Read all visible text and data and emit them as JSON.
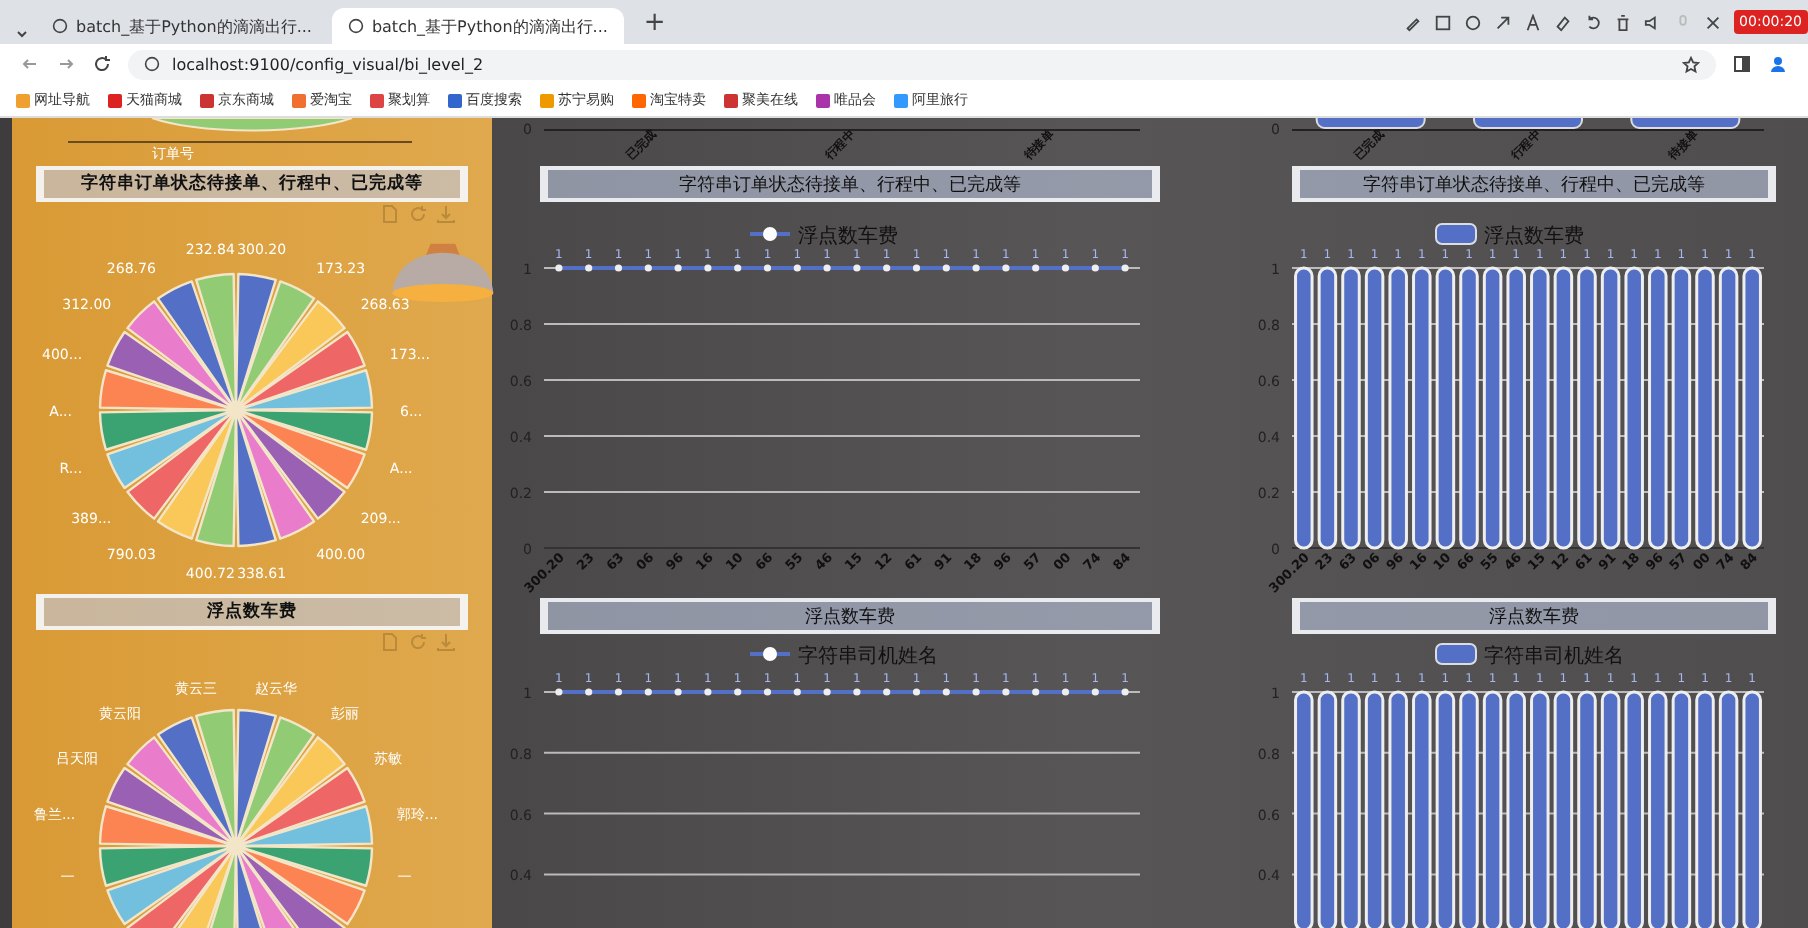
{
  "browser": {
    "tabs": [
      {
        "title": "batch_基于Python的滴滴出行...",
        "selected": false
      },
      {
        "title": "batch_基于Python的滴滴出行...",
        "selected": true
      }
    ],
    "new_tab": "+",
    "recording_time": "00:00:20",
    "url": "localhost:9100/config_visual/bi_level_2",
    "bookmarks": [
      "网址导航",
      "天猫商城",
      "京东商城",
      "爱淘宝",
      "聚划算",
      "百度搜索",
      "苏宁易购",
      "淘宝特卖",
      "聚美在线",
      "唯品会",
      "阿里旅行"
    ]
  },
  "dashboard": {
    "left_panel": {
      "top_pie_label": "订单号",
      "pies": [
        {
          "title": "字符串订单状态待接单、行程中、已完成等",
          "labels": [
            "300.20",
            "173.23",
            "268.63",
            "173...",
            "6...",
            "A...",
            "209...",
            "400.00",
            "338.61",
            "232.84",
            "268.76",
            "312.00",
            "400...",
            "A...",
            "R...",
            "389...",
            "790.03",
            "400.72"
          ]
        },
        {
          "title": "浮点数车费",
          "labels": [
            "赵云华",
            "彭丽",
            "苏敏",
            "郭玲...",
            "—",
            "黄云三",
            "黄云阳",
            "吕天阳",
            "鲁兰...",
            "—"
          ]
        }
      ]
    },
    "columns": [
      {
        "axis_tick": "0",
        "axis_labels": [
          "已完成",
          "行程中",
          "待接单"
        ],
        "top_title": "字符串订单状态待接单、行程中、已完成等",
        "bottom_title": "浮点数车费",
        "top_chart": {
          "chart_data": {
            "type": "line",
            "grid": true,
            "series": [
              {
                "name": "浮点数车费",
                "color": "#5470c6",
                "marker": true,
                "values": [
                  1,
                  1,
                  1,
                  1,
                  1,
                  1,
                  1,
                  1,
                  1,
                  1,
                  1,
                  1,
                  1,
                  1,
                  1,
                  1,
                  1,
                  1,
                  1,
                  1
                ]
              }
            ],
            "categories": [
              "300.20",
              "23",
              "63",
              "06",
              "96",
              "16",
              "10",
              "66",
              "55",
              "46",
              "15",
              "12",
              "61",
              "91",
              "18",
              "96",
              "57",
              "00",
              "74",
              "84"
            ],
            "ylim": [
              0,
              1
            ],
            "yticks": [
              0,
              0.2,
              0.4,
              0.6,
              0.8,
              1
            ],
            "data_labels": true
          }
        },
        "bottom_chart": {
          "chart_data": {
            "type": "line",
            "grid": true,
            "series": [
              {
                "name": "字符串司机姓名",
                "color": "#5470c6",
                "marker": true,
                "values": [
                  1,
                  1,
                  1,
                  1,
                  1,
                  1,
                  1,
                  1,
                  1,
                  1,
                  1,
                  1,
                  1,
                  1,
                  1,
                  1,
                  1,
                  1,
                  1,
                  1
                ]
              }
            ],
            "ylim": [
              0.4,
              1
            ],
            "yticks": [
              0.4,
              0.6,
              0.8,
              1
            ],
            "data_labels": true
          }
        }
      },
      {
        "axis_tick": "0",
        "axis_labels": [
          "已完成",
          "行程中",
          "待接单"
        ],
        "top_title": "字符串订单状态待接单、行程中、已完成等",
        "bottom_title": "浮点数车费",
        "top_chart": {
          "chart_data": {
            "type": "bar",
            "grid": true,
            "series": [
              {
                "name": "浮点数车费",
                "color": "#5470c6",
                "values": [
                  1,
                  1,
                  1,
                  1,
                  1,
                  1,
                  1,
                  1,
                  1,
                  1,
                  1,
                  1,
                  1,
                  1,
                  1,
                  1,
                  1,
                  1,
                  1,
                  1
                ]
              }
            ],
            "categories": [
              "300.20",
              "23",
              "63",
              "06",
              "96",
              "16",
              "10",
              "66",
              "55",
              "46",
              "15",
              "12",
              "61",
              "91",
              "18",
              "96",
              "57",
              "00",
              "74",
              "84"
            ],
            "ylim": [
              0,
              1
            ],
            "yticks": [
              0,
              0.2,
              0.4,
              0.6,
              0.8,
              1
            ],
            "data_labels": true
          }
        },
        "bottom_chart": {
          "chart_data": {
            "type": "bar",
            "grid": true,
            "series": [
              {
                "name": "字符串司机姓名",
                "color": "#5470c6",
                "values": [
                  1,
                  1,
                  1,
                  1,
                  1,
                  1,
                  1,
                  1,
                  1,
                  1,
                  1,
                  1,
                  1,
                  1,
                  1,
                  1,
                  1,
                  1,
                  1,
                  1
                ]
              }
            ],
            "ylim": [
              0.4,
              1
            ],
            "yticks": [
              0.4,
              0.6,
              0.8,
              1
            ],
            "data_labels": true
          }
        }
      }
    ]
  }
}
